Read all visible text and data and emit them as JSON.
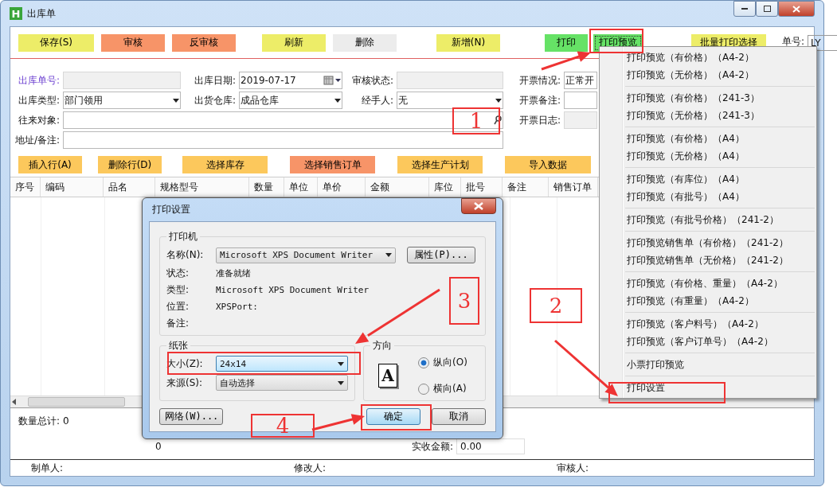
{
  "window": {
    "title": "出库单",
    "logo": "H"
  },
  "toolbar": {
    "groups": [
      [
        {
          "label": "保存(S)",
          "color": "#eded68",
          "selected": false
        },
        {
          "label": "审核",
          "color": "#f79468",
          "selected": false
        },
        {
          "label": "反审核",
          "color": "#f79468",
          "selected": false
        }
      ],
      [
        {
          "label": "刷新",
          "color": "#eded68",
          "selected": false
        },
        {
          "label": "删除",
          "color": "#ececec",
          "selected": false
        }
      ],
      [
        {
          "label": "新增(N)",
          "color": "#eded68",
          "selected": false
        }
      ],
      [
        {
          "label": "打印",
          "color": "#66e266",
          "selected": false
        },
        {
          "label": "打印预览",
          "color": "#66e266",
          "selected": true
        }
      ],
      [
        {
          "label": "批量打印选择",
          "color": "#eded68",
          "selected": false
        }
      ]
    ],
    "number_label": "单号:",
    "number_value": "LY"
  },
  "form": {
    "rows": [
      [
        {
          "label": "出库单号:",
          "kind": "text",
          "disabled": true,
          "emphasized": true
        },
        {
          "label": "出库日期:",
          "value": "2019-07-17",
          "kind": "date",
          "disabled": false,
          "emphasized": false
        },
        {
          "label": "审核状态:",
          "kind": "text",
          "disabled": true,
          "emphasized": false
        },
        {
          "label": "开票情况:",
          "value": "正常开",
          "kind": "text",
          "disabled": false,
          "emphasized": false
        }
      ],
      [
        {
          "label": "出库类型:",
          "value": "部门领用",
          "kind": "select",
          "disabled": false,
          "emphasized": false
        },
        {
          "label": "出货仓库:",
          "value": "成品仓库",
          "kind": "select",
          "disabled": false,
          "emphasized": false
        },
        {
          "label": "经手人:",
          "value": "无",
          "kind": "select",
          "disabled": false,
          "emphasized": false
        },
        {
          "label": "开票备注:",
          "kind": "text",
          "disabled": false,
          "emphasized": false
        }
      ],
      [
        {
          "label": "往来对象:",
          "kind": "search",
          "disabled": false,
          "emphasized": false
        },
        null,
        null,
        {
          "label": "开票日志:",
          "kind": "text",
          "disabled": true,
          "emphasized": false
        }
      ],
      [
        {
          "label": "地址/备注:",
          "kind": "text",
          "disabled": false,
          "emphasized": false
        },
        null,
        null
      ]
    ]
  },
  "actions": [
    {
      "label": "插入行(A)",
      "color": "#fcc85c"
    },
    {
      "label": "删除行(D)",
      "color": "#fcc85c"
    },
    {
      "label": "选择库存",
      "color": "#fcc85c"
    },
    {
      "label": "选择销售订单",
      "color": "#f79468"
    },
    {
      "label": "选择生产计划",
      "color": "#fcc85c"
    },
    {
      "label": "导入数据",
      "color": "#fcc85c"
    }
  ],
  "table": {
    "columns": [
      "序号",
      "编码",
      "品名",
      "规格型号",
      "数量",
      "单位",
      "单价",
      "金额",
      "库位",
      "批号",
      "备注",
      "销售订单"
    ]
  },
  "summary": {
    "total_label": "数量总计:",
    "total_value": "0",
    "value_2": "0",
    "received_label": "实收金额:",
    "received_value": "0.00"
  },
  "status_bar": [
    "制单人:",
    "修改人:",
    "审核人:"
  ],
  "menu": {
    "groups": [
      [
        "打印预览（有价格）（A4-2）",
        "打印预览（无价格）（A4-2）"
      ],
      [
        "打印预览（有价格）（241-3）",
        "打印预览（无价格）（241-3）"
      ],
      [
        "打印预览（有价格）（A4）",
        "打印预览（无价格）（A4）"
      ],
      [
        "打印预览（有库位）（A4）",
        "打印预览（有批号）（A4）"
      ],
      [
        "打印预览（有批号价格）（241-2）"
      ],
      [
        "打印预览销售单（有价格）（241-2）",
        "打印预览销售单（无价格）（241-2）"
      ],
      [
        "打印预览（有价格、重量）（A4-2）",
        "打印预览（有重量）（A4-2）"
      ],
      [
        "打印预览（客户料号）（A4-2）",
        "打印预览（客户订单号）（A4-2）"
      ],
      [
        "小票打印预览"
      ],
      [
        "打印设置"
      ]
    ]
  },
  "dialog": {
    "title": "打印设置",
    "printer": {
      "group_label": "打印机",
      "name_label": "名称(N):",
      "name_value": "Microsoft XPS Document Writer",
      "properties_button": "属性(P)...",
      "info": [
        {
          "label": "状态:",
          "value": "准备就绪"
        },
        {
          "label": "类型:",
          "value": "Microsoft XPS Document Writer"
        },
        {
          "label": "位置:",
          "value": "XPSPort:"
        },
        {
          "label": "备注:"
        }
      ]
    },
    "paper": {
      "group_label": "纸张",
      "fields": [
        {
          "label": "大小(Z):",
          "value": "24x14",
          "focused": true
        },
        {
          "label": "来源(S):",
          "value": "自动选择",
          "focused": false
        }
      ]
    },
    "orientation": {
      "group_label": "方向",
      "page_glyph": "A",
      "options": [
        {
          "label": "纵向(O)",
          "selected": true
        },
        {
          "label": "横向(A)",
          "selected": false
        }
      ]
    },
    "buttons": [
      {
        "label": "网络(W)...",
        "default": false
      },
      {
        "label": "确定",
        "default": true
      },
      {
        "label": "取消",
        "default": false
      }
    ]
  },
  "callouts": [
    "1",
    "2",
    "3",
    "4"
  ]
}
